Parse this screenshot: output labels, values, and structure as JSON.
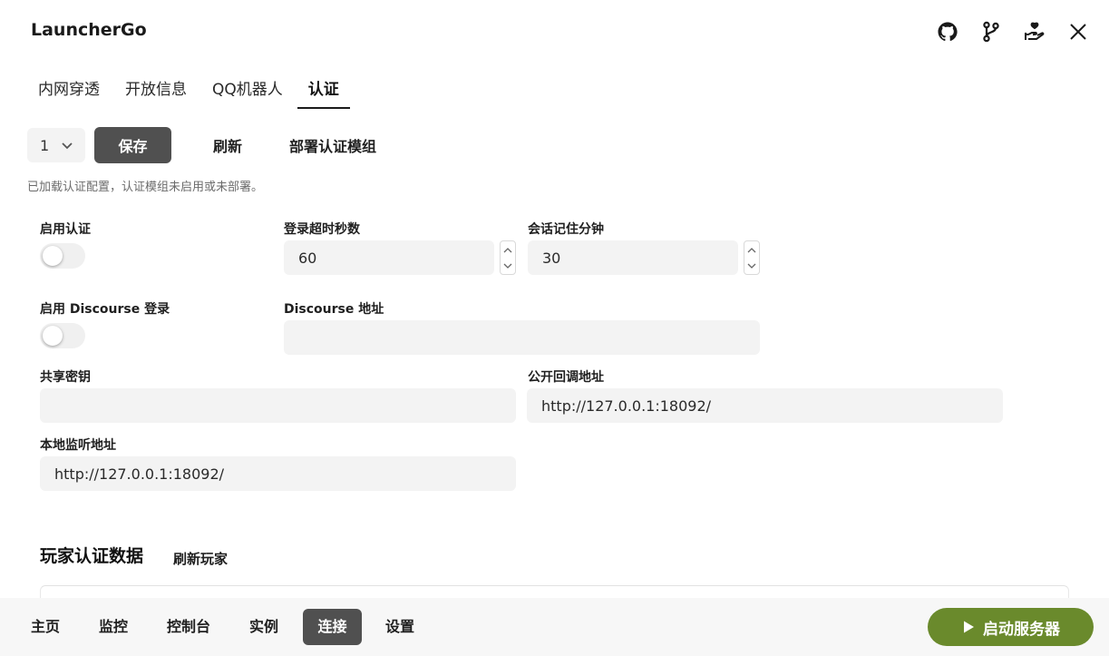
{
  "app": {
    "title": "LauncherGo"
  },
  "window_icons": [
    "github-icon",
    "git-branch-icon",
    "donate-hand-icon",
    "close-icon"
  ],
  "tabs": [
    {
      "label": "内网穿透",
      "active": false
    },
    {
      "label": "开放信息",
      "active": false
    },
    {
      "label": "QQ机器人",
      "active": false
    },
    {
      "label": "认证",
      "active": true
    }
  ],
  "toolbar": {
    "select_value": "1",
    "save_label": "保存",
    "refresh_label": "刷新",
    "deploy_label": "部署认证模组"
  },
  "status_message": "已加载认证配置，认证模组未启用或未部署。",
  "form": {
    "enable_auth": {
      "label": "启用认证",
      "on": false
    },
    "login_timeout": {
      "label": "登录超时秒数",
      "value": "60"
    },
    "session_minutes": {
      "label": "会话记住分钟",
      "value": "30"
    },
    "enable_discourse": {
      "label": "启用 Discourse 登录",
      "on": false
    },
    "discourse_url": {
      "label": "Discourse 地址",
      "value": ""
    },
    "shared_secret": {
      "label": "共享密钥",
      "value": ""
    },
    "public_callback": {
      "label": "公开回调地址",
      "value": "http://127.0.0.1:18092/"
    },
    "local_listen": {
      "label": "本地监听地址",
      "value": "http://127.0.0.1:18092/"
    }
  },
  "players_section": {
    "title": "玩家认证数据",
    "refresh_label": "刷新玩家"
  },
  "bottom_nav": [
    {
      "label": "主页",
      "active": false
    },
    {
      "label": "监控",
      "active": false
    },
    {
      "label": "控制台",
      "active": false
    },
    {
      "label": "实例",
      "active": false
    },
    {
      "label": "连接",
      "active": true
    },
    {
      "label": "设置",
      "active": false
    }
  ],
  "start_button": {
    "label": "启动服务器"
  },
  "colors": {
    "accent": "#6a8a2c",
    "primary_button": "#505050",
    "input_bg": "#f3f3f3"
  }
}
